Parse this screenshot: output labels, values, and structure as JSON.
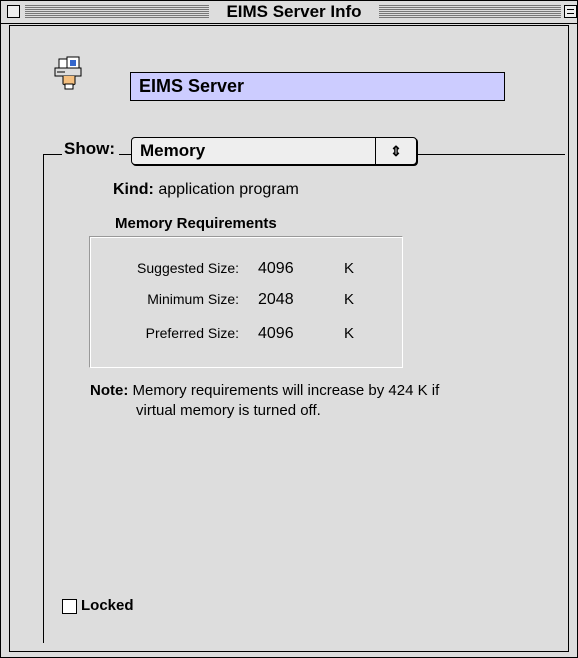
{
  "window": {
    "title": "EIMS Server Info"
  },
  "name_field": {
    "value": "EIMS Server"
  },
  "show": {
    "label": "Show:",
    "selected": "Memory",
    "arrows_icon": "up-down-arrows"
  },
  "kind": {
    "label": "Kind:",
    "value": "application program"
  },
  "memory": {
    "title": "Memory Requirements",
    "rows": [
      {
        "label": "Suggested Size:",
        "value": "4096",
        "unit": "K"
      },
      {
        "label": "Minimum Size:",
        "value": "2048",
        "unit": "K"
      },
      {
        "label": "Preferred Size:",
        "value": "4096",
        "unit": "K"
      }
    ]
  },
  "note": {
    "label": "Note:",
    "line1": "Memory requirements will increase by 424 K if",
    "line2": "virtual memory is turned off."
  },
  "locked": {
    "label": "Locked",
    "checked": false
  },
  "colors": {
    "window_bg": "#dddddd",
    "name_field_bg": "#ccccff"
  }
}
